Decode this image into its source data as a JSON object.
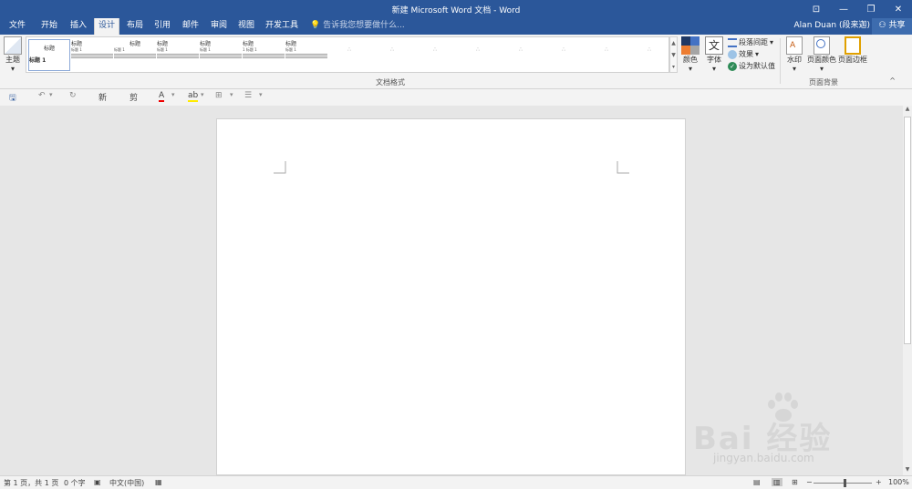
{
  "window": {
    "title": "新建 Microsoft Word 文档 - Word",
    "buttons": [
      "⊡",
      "—",
      "❐",
      "✕"
    ]
  },
  "tabs": [
    {
      "label": "文件"
    },
    {
      "label": "开始"
    },
    {
      "label": "插入"
    },
    {
      "label": "设计"
    },
    {
      "label": "布局"
    },
    {
      "label": "引用"
    },
    {
      "label": "邮件"
    },
    {
      "label": "审阅"
    },
    {
      "label": "视图"
    },
    {
      "label": "开发工具"
    }
  ],
  "tell_me": "告诉我您想要做什么...",
  "user": "Alan Duan (段来迦)",
  "share": "共享",
  "ribbon": {
    "theme": "主题",
    "styles": [
      {
        "title": "标题",
        "heading": "标题 1"
      },
      {
        "title": "标题",
        "heading": "标题 1"
      },
      {
        "title": "标题",
        "heading": "标题 1"
      },
      {
        "title": "标题",
        "heading": "标题 1"
      },
      {
        "title": "标题",
        "heading": "标题 1"
      },
      {
        "title": "标题",
        "heading": "1 标题 1"
      },
      {
        "title": "标题",
        "heading": "标题 1"
      }
    ],
    "group_doc_format": "文档格式",
    "colors": "颜色",
    "fonts": "字体",
    "paragraph_spacing": "段落间距",
    "effects": "效果",
    "set_default": "设为默认值",
    "watermark": "水印",
    "page_color": "页面颜色",
    "page_borders": "页面边框",
    "group_page_background": "页面背景"
  },
  "status": {
    "page": "第 1 页，共 1 页",
    "words": "0 个字",
    "language": "中文(中国)",
    "zoom": "100%"
  },
  "watermark_text": {
    "main": "Bai 经验",
    "sub": "jingyan.baidu.com"
  }
}
